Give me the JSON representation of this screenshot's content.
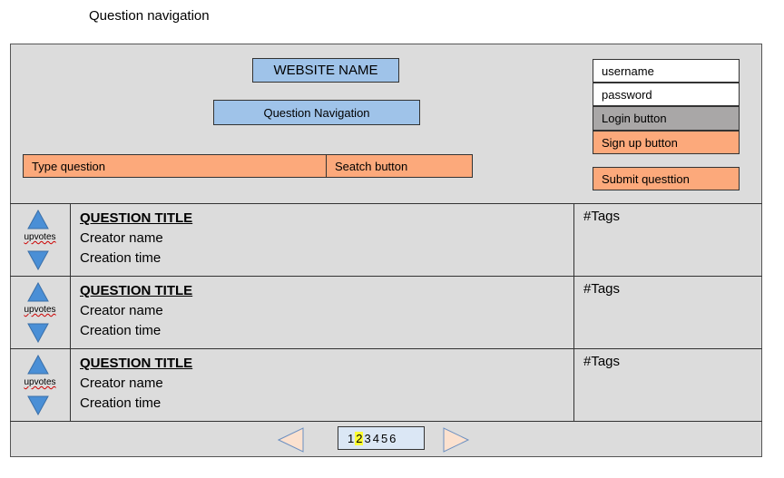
{
  "caption": "Question navigation",
  "header": {
    "site_name": "WEBSITE NAME",
    "nav_label": "Question Navigation",
    "search_placeholder": "Type question",
    "search_button": "Seatch button"
  },
  "auth": {
    "username": "username",
    "password": "password",
    "login": "Login button",
    "signup": "Sign up button",
    "submit": "Submit questtion"
  },
  "questions": [
    {
      "upvote_label": "upvotes",
      "title": "QUESTION TITLE",
      "creator": "Creator name",
      "time": "Creation time",
      "tags": "#Tags"
    },
    {
      "upvote_label": "upvotes",
      "title": "QUESTION TITLE",
      "creator": "Creator name",
      "time": "Creation time",
      "tags": "#Tags"
    },
    {
      "upvote_label": "upvotes",
      "title": "QUESTION TITLE",
      "creator": "Creator name",
      "time": "Creation time",
      "tags": "#Tags"
    }
  ],
  "pagination": {
    "pages": [
      "1",
      "2",
      "3",
      "4",
      "5",
      "6"
    ],
    "current": "2"
  },
  "colors": {
    "blue_box": "#9fc3e9",
    "orange_box": "#fca97b",
    "gray_button": "#a9a7a7",
    "vote_arrow": "#4a8fd6",
    "pager_arrow_fill": "#fbe1cf",
    "pager_arrow_stroke": "#6b8fc1",
    "current_page_highlight": "#ffff33"
  },
  "icons": {
    "upvote": "triangle-up-icon",
    "downvote": "triangle-down-icon",
    "prev": "triangle-left-icon",
    "next": "triangle-right-icon"
  }
}
